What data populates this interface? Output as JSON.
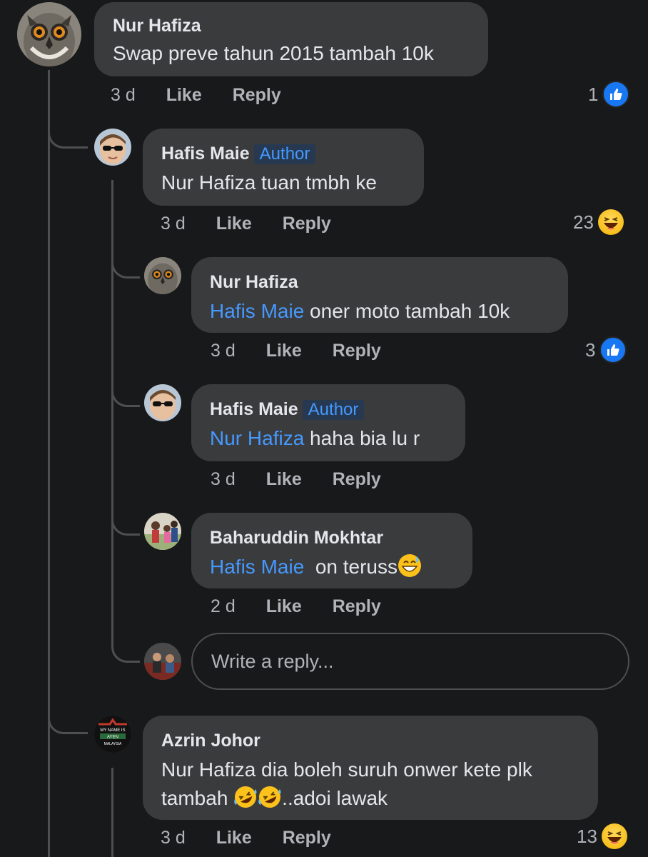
{
  "comments": [
    {
      "name": "Nur Hafiza",
      "text": "Swap preve tahun 2015 tambah 10k",
      "time": "3 d",
      "like": "Like",
      "reply": "Reply",
      "reaction_count": "1",
      "reaction": "like-icon"
    },
    {
      "name": "Hafis Maie",
      "badge": "Author",
      "text": "Nur Hafiza tuan tmbh ke",
      "time": "3 d",
      "like": "Like",
      "reply": "Reply",
      "reaction_count": "23",
      "reaction": "haha-icon"
    },
    {
      "name": "Nur Hafiza",
      "mention": "Hafis Maie",
      "text": " oner moto tambah 10k",
      "time": "3 d",
      "like": "Like",
      "reply": "Reply",
      "reaction_count": "3",
      "reaction": "like-icon"
    },
    {
      "name": "Hafis Maie",
      "badge": "Author",
      "mention": "Nur Hafiza",
      "text": " haha bia lu r",
      "time": "3 d",
      "like": "Like",
      "reply": "Reply"
    },
    {
      "name": "Baharuddin Mokhtar",
      "mention": "Hafis Maie",
      "text": "  on teruss",
      "emoji": "sweat-smile-emoji",
      "time": "2 d",
      "like": "Like",
      "reply": "Reply"
    },
    {
      "name": "Azrin Johor",
      "text_line1": "Nur Hafiza dia boleh suruh onwer kete plk",
      "text_line2_pre": "tambah ",
      "text_line2_post": "..adoi lawak",
      "emoji": "rofl-emoji",
      "time": "3 d",
      "like": "Like",
      "reply": "Reply",
      "reaction_count": "13",
      "reaction": "haha-icon"
    }
  ],
  "reply_box": {
    "placeholder": "Write a reply..."
  },
  "avatar_5_text": [
    "MY NAME IS",
    "AYEN",
    "MALAYSIA"
  ],
  "colors": {
    "background": "#18191a",
    "bubble": "#3a3b3c",
    "mention": "#4599ff",
    "like_badge": "#1877f2"
  }
}
